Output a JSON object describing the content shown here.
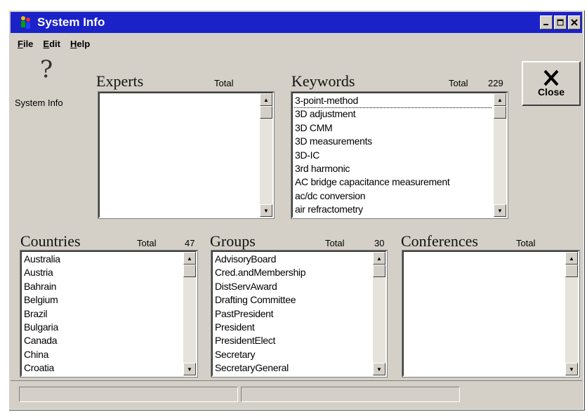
{
  "window": {
    "title": "System Info"
  },
  "menu": {
    "file": "File",
    "edit": "Edit",
    "help": "Help"
  },
  "sidebar": {
    "icon": "question-icon",
    "glyph": "?",
    "label": "System Info"
  },
  "experts": {
    "title": "Experts",
    "total_label": "Total",
    "total": "",
    "items": []
  },
  "keywords": {
    "title": "Keywords",
    "total_label": "Total",
    "total": "229",
    "items": [
      "3-point-method",
      "3D adjustment",
      "3D CMM",
      "3D measurements",
      "3D-IC",
      "3rd harmonic",
      "AC bridge capacitance measurement",
      "ac/dc conversion",
      "air refractometry"
    ]
  },
  "countries": {
    "title": "Countries",
    "total_label": "Total",
    "total": "47",
    "items": [
      "Australia",
      "Austria",
      "Bahrain",
      "Belgium",
      "Brazil",
      "Bulgaria",
      "Canada",
      "China",
      "Croatia"
    ]
  },
  "groups": {
    "title": "Groups",
    "total_label": "Total",
    "total": "30",
    "items": [
      "AdvisoryBoard",
      "Cred.andMembership",
      "DistServAward",
      "Drafting Committee",
      "PastPresident",
      "President",
      "PresidentElect",
      "Secretary",
      "SecretaryGeneral"
    ]
  },
  "conferences": {
    "title": "Conferences",
    "total_label": "Total",
    "total": "",
    "items": []
  },
  "close_button": {
    "label": "Close",
    "icon": "close-x-icon"
  },
  "colors": {
    "titlebar": "#1a22c8",
    "face": "#d4d0c8"
  }
}
